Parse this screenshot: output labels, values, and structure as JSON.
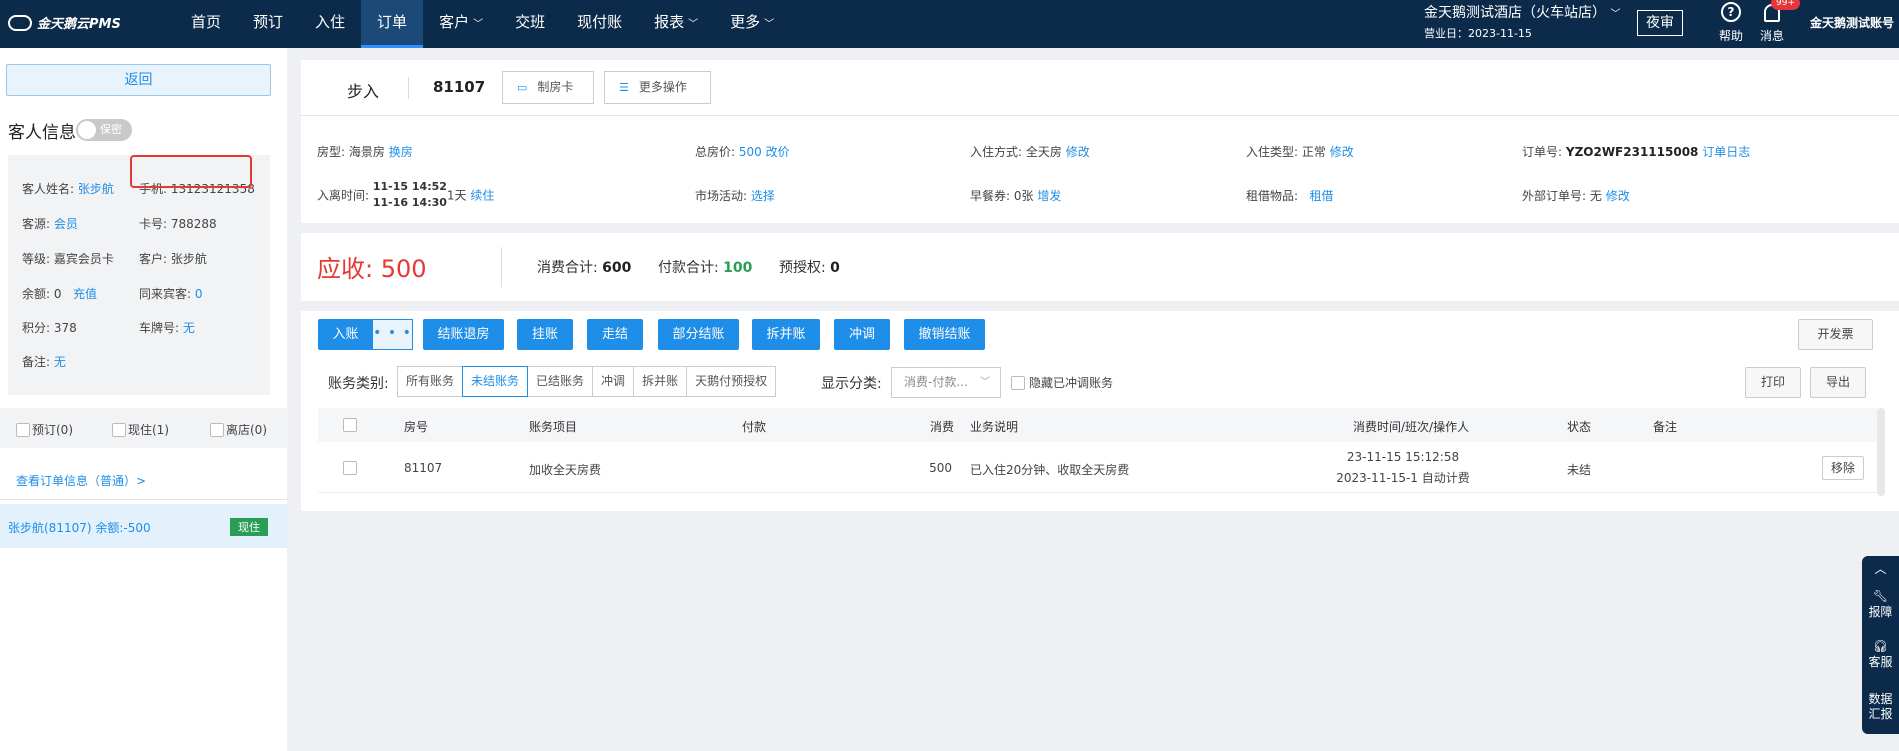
{
  "app": {
    "logo": "金天鹅云PMS"
  },
  "nav": {
    "items": [
      {
        "label": "首页",
        "dropdown": false
      },
      {
        "label": "预订",
        "dropdown": false
      },
      {
        "label": "入住",
        "dropdown": false
      },
      {
        "label": "订单",
        "dropdown": false,
        "active": true
      },
      {
        "label": "客户",
        "dropdown": true
      },
      {
        "label": "交班",
        "dropdown": false
      },
      {
        "label": "现付账",
        "dropdown": false
      },
      {
        "label": "报表",
        "dropdown": true
      },
      {
        "label": "更多",
        "dropdown": true
      }
    ],
    "hotel_name": "金天鹅测试酒店（火车站店）",
    "business_day": "营业日：2023-11-15",
    "night_audit": "夜审",
    "help": "帮助",
    "messages": "消息",
    "message_badge": "99+",
    "user": "金天鹅测试账号"
  },
  "sidebar": {
    "back": "返回",
    "guest_title": "客人信息",
    "privacy_toggle": "保密",
    "guest": {
      "name_label": "客人姓名:",
      "name": "张步航",
      "phone": "手机: 13123121358",
      "source_label": "客源:",
      "source": "会员",
      "card": "卡号: 788288",
      "level": "等级: 嘉宾会员卡",
      "customer": "客户: 张步航",
      "balance_label": "余额: 0",
      "recharge": "充值",
      "companion_label": "同来宾客:",
      "companion": "0",
      "points": "积分: 378",
      "plate_label": "车牌号:",
      "plate": "无",
      "remark_label": "备注:",
      "remark": "无"
    },
    "status_tabs": [
      "预订(0)",
      "现住(1)",
      "离店(0)"
    ],
    "view_order": "查看订单信息（普通）>",
    "guest_row": {
      "text": "张步航(81107)   余额:-500",
      "badge": "现住"
    }
  },
  "header": {
    "status": "步入",
    "room": "81107",
    "make_card": "制房卡",
    "more_ops": "更多操作"
  },
  "info": {
    "room_type_label": "房型:",
    "room_type": "海景房",
    "change_room": "换房",
    "total_price_label": "总房价:",
    "total_price": "500",
    "change_price": "改价",
    "checkin_mode_label": "入住方式:",
    "checkin_mode": "全天房",
    "modify": "修改",
    "checkin_type_label": "入住类型:",
    "checkin_type": "正常",
    "order_no_label": "订单号:",
    "order_no": "YZO2WF231115008",
    "order_log": "订单日志",
    "stay_label": "入离时间:",
    "checkin_time": "11-15 14:52",
    "checkout_time": "11-16 14:30",
    "nights": "1天",
    "extend": "续住",
    "market_label": "市场活动:",
    "market_select": "选择",
    "breakfast_label": "早餐券:",
    "breakfast": "0张",
    "add_breakfast": "增发",
    "rental_label": "租借物品:",
    "rental": "租借",
    "ext_order_label": "外部订单号:",
    "ext_order": "无"
  },
  "summary": {
    "receivable_label": "应收:",
    "receivable": "500",
    "consume_label": "消费合计:",
    "consume": "600",
    "pay_label": "付款合计:",
    "pay": "100",
    "preauth_label": "预授权:",
    "preauth": "0"
  },
  "actions": {
    "post": "入账",
    "more": "• • •",
    "buttons": [
      "结账退房",
      "挂账",
      "走结",
      "部分结账",
      "拆并账",
      "冲调",
      "撤销结账"
    ],
    "invoice": "开发票",
    "print": "打印",
    "export": "导出"
  },
  "filters": {
    "category_label": "账务类别:",
    "categories": [
      "所有账务",
      "未结账务",
      "已结账务",
      "冲调",
      "拆并账",
      "天鹅付预授权"
    ],
    "selected_category": "未结账务",
    "display_label": "显示分类:",
    "display_select": "消费-付款...",
    "hide_reversed": "隐藏已冲调账务"
  },
  "table": {
    "headers": [
      "房号",
      "账务项目",
      "付款",
      "消费",
      "业务说明",
      "消费时间/班次/操作人",
      "状态",
      "备注"
    ],
    "rows": [
      {
        "room": "81107",
        "item": "加收全天房费",
        "payment": "",
        "consume": "500",
        "desc": "已入住20分钟、收取全天房费",
        "time1": "23-11-15 15:12:58",
        "time2": "2023-11-15-1 自动计费",
        "status": "未结",
        "remark": "",
        "remove": "移除"
      }
    ]
  },
  "right_toolbar": {
    "report": "报障",
    "service": "客服",
    "data": "数据汇报"
  }
}
